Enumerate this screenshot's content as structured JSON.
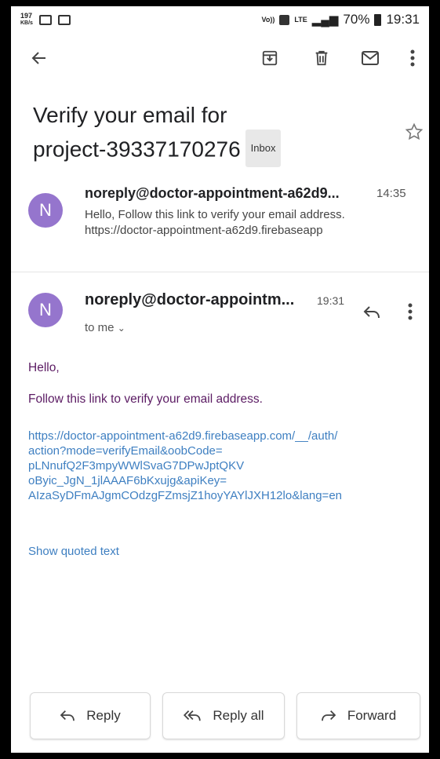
{
  "status_bar": {
    "speed_value": "197",
    "speed_unit": "KB/s",
    "volte": "Vo))",
    "lte": "LTE",
    "battery": "70%",
    "time": "19:31"
  },
  "toolbar": {
    "back_icon": "arrow-left-icon",
    "archive_icon": "archive-icon",
    "delete_icon": "trash-icon",
    "mail_icon": "mail-icon",
    "more_icon": "more-vert-icon"
  },
  "email": {
    "subject_line1": "Verify your email for",
    "subject_line2": "project-39337170276",
    "label": "Inbox"
  },
  "messages": [
    {
      "avatar": "N",
      "sender": "noreply@doctor-appointment-a62d9...",
      "time": "14:35",
      "snippet_line1": "Hello, Follow this link to verify your email address.",
      "snippet_line2": "https://doctor-appointment-a62d9.firebaseapp"
    },
    {
      "avatar": "N",
      "sender": "noreply@doctor-appointm...",
      "time": "19:31",
      "to": "to me",
      "greeting": "Hello,",
      "instruction": "Follow this link to verify your email address.",
      "link_lines": [
        "https://doctor-appointment-a62d9.firebaseapp.com/__/auth/",
        "action?mode=verifyEmail&oobCode=",
        "pLNnufQ2F3mpyWWlSvaG7DPwJptQKV",
        "oByic_JgN_1jlAAAF6bKxujg&apiKey=",
        "AIzaSyDFmAJgmCOdzgFZmsjZ1hoyYAYlJXH12lo&lang=en"
      ],
      "show_quoted": "Show quoted text"
    }
  ],
  "actions": {
    "reply": "Reply",
    "reply_all": "Reply all",
    "forward": "Forward"
  }
}
